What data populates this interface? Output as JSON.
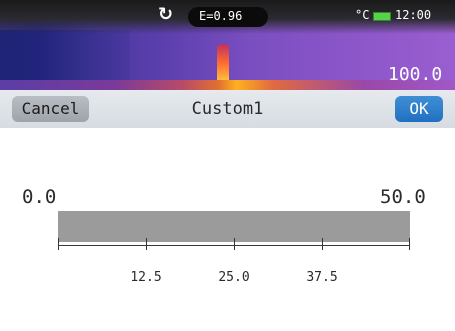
{
  "status": {
    "emissivity": "E=0.96",
    "unit": "°C",
    "time": "12:00",
    "scale_max": "100.0"
  },
  "header": {
    "cancel_label": "Cancel",
    "title": "Custom1",
    "ok_label": "OK"
  },
  "range": {
    "min_label": "0.0",
    "max_label": "50.0",
    "ticks": [
      "12.5",
      "25.0",
      "37.5"
    ]
  },
  "colors": {
    "ok_button": "#2f7fcc",
    "cancel_button": "#a9aeb4",
    "range_bar": "#9b9b9b"
  }
}
